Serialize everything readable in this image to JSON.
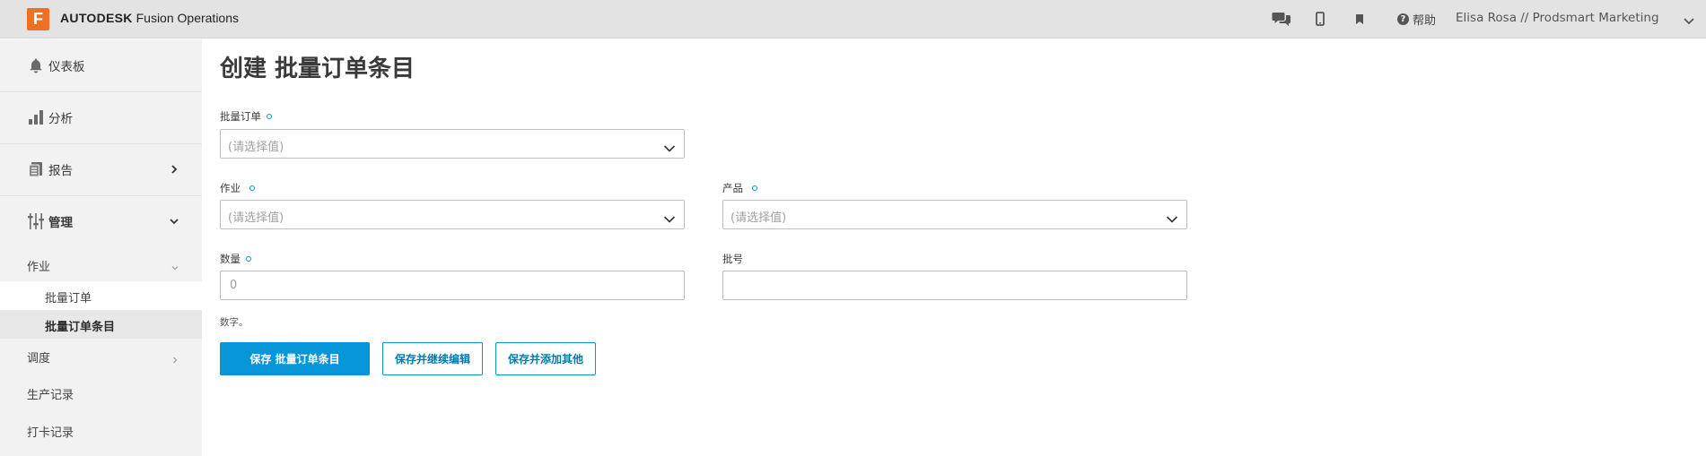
{
  "brand": {
    "logo_letter": "F",
    "name_bold": "AUTODESK",
    "name_rest": " Fusion Operations",
    "accent": "#f26f21"
  },
  "header": {
    "help_label": "帮助",
    "user_label": "Elisa Rosa // Prodsmart Marketing",
    "icons": [
      "chat-icon",
      "mobile-icon",
      "bookmark-icon",
      "help-icon",
      "chevron-down-icon"
    ]
  },
  "sidebar": {
    "items": [
      {
        "label": "仪表板",
        "icon": "bell-icon"
      },
      {
        "label": "分析",
        "icon": "bar-chart-icon"
      },
      {
        "label": "报告",
        "icon": "report-icon",
        "chevron": "right"
      },
      {
        "label": "管理",
        "icon": "sliders-icon",
        "chevron": "down",
        "expanded": true
      }
    ],
    "groups": [
      {
        "label": "作业",
        "chevron": "down",
        "children": [
          "批量订单",
          "批量订单条目"
        ],
        "active_child": "批量订单条目"
      },
      {
        "label": "调度",
        "chevron": "right"
      },
      {
        "label": "生产记录"
      },
      {
        "label": "打卡记录"
      }
    ]
  },
  "main": {
    "title": "创建 批量订单条目",
    "fields": {
      "batch_order": {
        "label": "批量订单",
        "placeholder": "(请选择值)",
        "required": true
      },
      "job": {
        "label": "作业",
        "placeholder": "(请选择值)",
        "required": true
      },
      "product": {
        "label": "产品",
        "placeholder": "(请选择值)",
        "required": true
      },
      "quantity": {
        "label": "数量",
        "placeholder": "0",
        "required": true,
        "hint": "数字。"
      },
      "lot_number": {
        "label": "批号",
        "placeholder": "",
        "required": false
      }
    },
    "buttons": {
      "save": "保存 批量订单条目",
      "save_continue": "保存并继续编辑",
      "save_add": "保存并添加其他"
    }
  },
  "colors": {
    "primary": "#0696d7",
    "sidebar_bg": "#f2f2f2",
    "topbar_bg": "#e3e3e3"
  }
}
